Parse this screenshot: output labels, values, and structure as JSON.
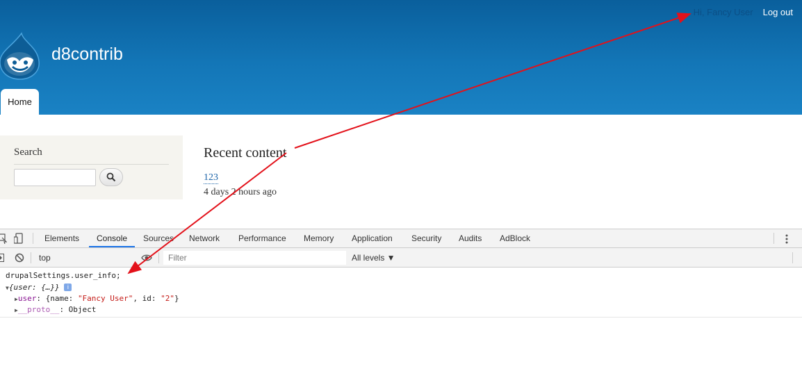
{
  "header": {
    "greeting": "Hi, Fancy User",
    "logout": "Log out",
    "site_name": "d8contrib",
    "tab_home": "Home"
  },
  "sidebar": {
    "search_title": "Search",
    "search_placeholder": ""
  },
  "main": {
    "recent_title": "Recent content",
    "node_title": "123",
    "node_time": "4 days 2 hours ago"
  },
  "devtools": {
    "tabs": [
      "Elements",
      "Console",
      "Sources",
      "Network",
      "Performance",
      "Memory",
      "Application",
      "Security",
      "Audits",
      "AdBlock"
    ],
    "active_tab": "Console",
    "context": "top",
    "filter_placeholder": "Filter",
    "levels": "All levels ▼",
    "console": {
      "input": "drupalSettings.user_info;",
      "object_summary": "{user: {…}}",
      "info_badge": "i",
      "user_key": "user",
      "user_value_prefix": ": {name: ",
      "user_name": "\"Fancy User\"",
      "user_value_mid": ", id: ",
      "user_id": "\"2\"",
      "user_value_suffix": "}",
      "proto_key": "__proto__",
      "proto_value": ": Object"
    }
  },
  "colors": {
    "header_blue": "#1376b7",
    "devtools_accent": "#1a73e8",
    "annotation_arrow": "#e3111a"
  }
}
